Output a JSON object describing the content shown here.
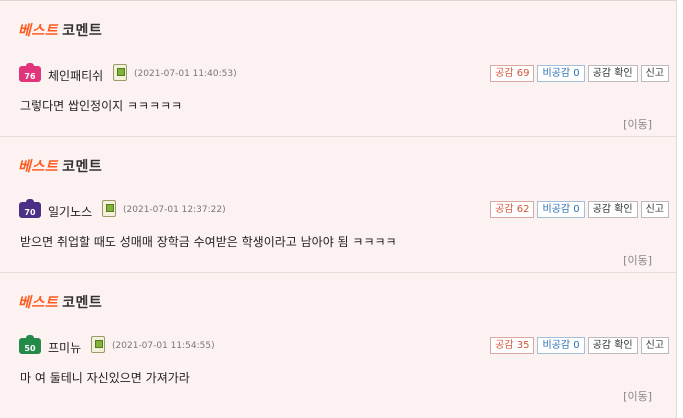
{
  "comments": [
    {
      "section_title_best": "베스트",
      "section_title_rest": "코멘트",
      "level": "76",
      "level_color": "#e0357b",
      "nickname": "체인패티쉬",
      "date": "(2021-07-01 11:40:53)",
      "like_label": "공감 69",
      "dislike_label": "비공감 0",
      "confirm_label": "공감 확인",
      "report_label": "신고",
      "text": "그렇다면  쌉인정이지  ㅋㅋㅋㅋㅋ",
      "move_label": "[이동]"
    },
    {
      "section_title_best": "베스트",
      "section_title_rest": "코멘트",
      "level": "70",
      "level_color": "#4b2e86",
      "nickname": "일기노스",
      "date": "(2021-07-01 12:37:22)",
      "like_label": "공감 62",
      "dislike_label": "비공감 0",
      "confirm_label": "공감 확인",
      "report_label": "신고",
      "text": "받으면  취업할  때도  성매매  장학금  수여받은  학생이라고  남아야  됨  ㅋㅋㅋㅋ",
      "move_label": "[이동]"
    },
    {
      "section_title_best": "베스트",
      "section_title_rest": "코멘트",
      "level": "50",
      "level_color": "#238a4a",
      "nickname": "프미뉴",
      "date": "(2021-07-01 11:54:55)",
      "like_label": "공감 35",
      "dislike_label": "비공감 0",
      "confirm_label": "공감 확인",
      "report_label": "신고",
      "text": "마  여  둘테니  자신있으면  가져가라",
      "move_label": "[이동]"
    }
  ]
}
